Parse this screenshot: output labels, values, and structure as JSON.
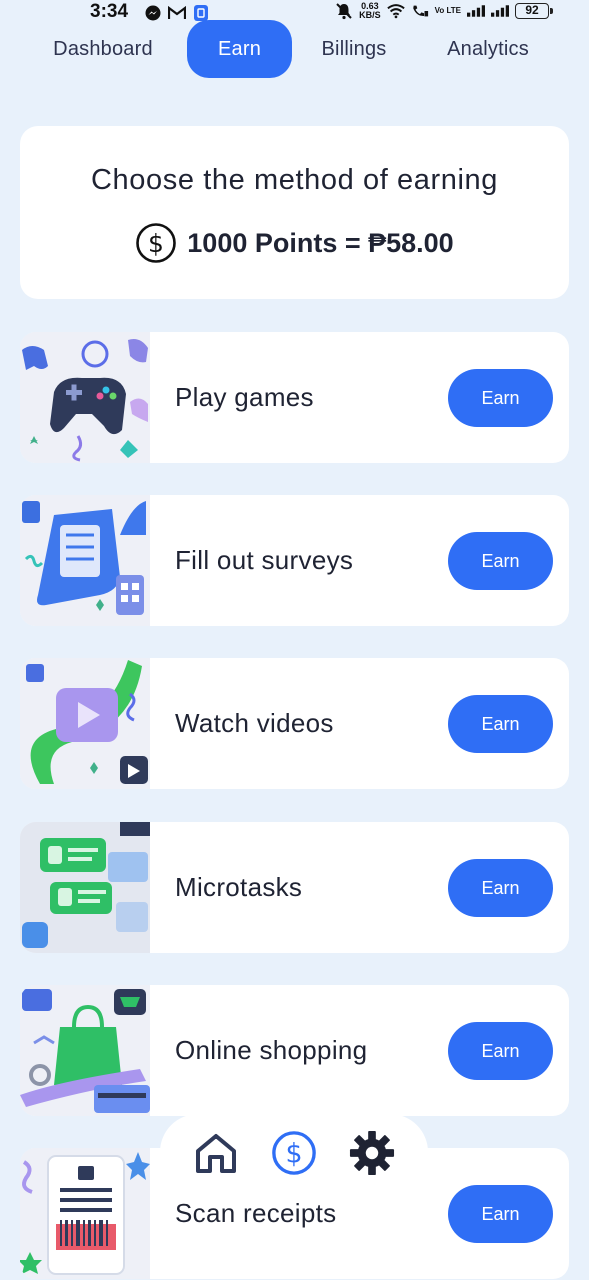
{
  "status_bar": {
    "time": "3:34",
    "speed_value": "0.63",
    "speed_unit": "KB/S",
    "volte": "Vo LTE",
    "battery": "92"
  },
  "tabs": [
    {
      "label": "Dashboard",
      "active": false
    },
    {
      "label": "Earn",
      "active": true
    },
    {
      "label": "Billings",
      "active": false
    },
    {
      "label": "Analytics",
      "active": false
    }
  ],
  "header": {
    "title": "Choose the method of earning",
    "rate": "1000 Points = ₱58.00"
  },
  "methods": [
    {
      "label": "Play games",
      "button": "Earn",
      "icon": "gamepad-icon"
    },
    {
      "label": "Fill out surveys",
      "button": "Earn",
      "icon": "survey-icon"
    },
    {
      "label": "Watch videos",
      "button": "Earn",
      "icon": "video-icon"
    },
    {
      "label": "Microtasks",
      "button": "Earn",
      "icon": "tasks-icon"
    },
    {
      "label": "Online shopping",
      "button": "Earn",
      "icon": "shopping-icon"
    },
    {
      "label": "Scan receipts",
      "button": "Earn",
      "icon": "receipt-icon"
    }
  ],
  "bottom_nav": [
    "home-icon",
    "dollar-coin-icon",
    "gear-icon"
  ],
  "colors": {
    "accent": "#2f6ef5",
    "background": "#e8f1fb",
    "card": "#ffffff",
    "text": "#1f2333"
  }
}
